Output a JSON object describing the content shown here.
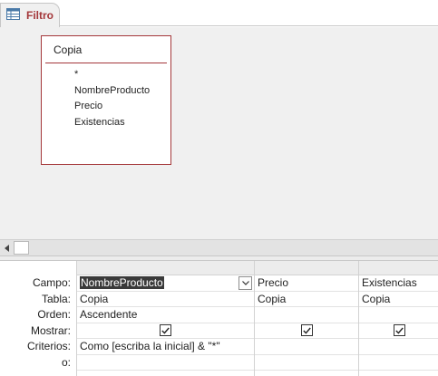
{
  "tab": {
    "label": "Filtro",
    "icon": "query-icon"
  },
  "table_box": {
    "title": "Copia",
    "fields": [
      "*",
      "NombreProducto",
      "Precio",
      "Existencias"
    ]
  },
  "grid": {
    "row_labels": [
      "Campo:",
      "Tabla:",
      "Orden:",
      "Mostrar:",
      "Criterios:",
      "o:"
    ],
    "columns": [
      {
        "campo": "NombreProducto",
        "tabla": "Copia",
        "orden": "Ascendente",
        "mostrar": true,
        "criterios": "Como [escriba la inicial] & \"*\"",
        "o": ""
      },
      {
        "campo": "Precio",
        "tabla": "Copia",
        "orden": "",
        "mostrar": true,
        "criterios": "",
        "o": ""
      },
      {
        "campo": "Existencias",
        "tabla": "Copia",
        "orden": "",
        "mostrar": true,
        "criterios": "",
        "o": ""
      }
    ]
  },
  "colors": {
    "accent": "#a4373a",
    "selection": "#3a3a3a",
    "surface": "#f0f0f0"
  }
}
